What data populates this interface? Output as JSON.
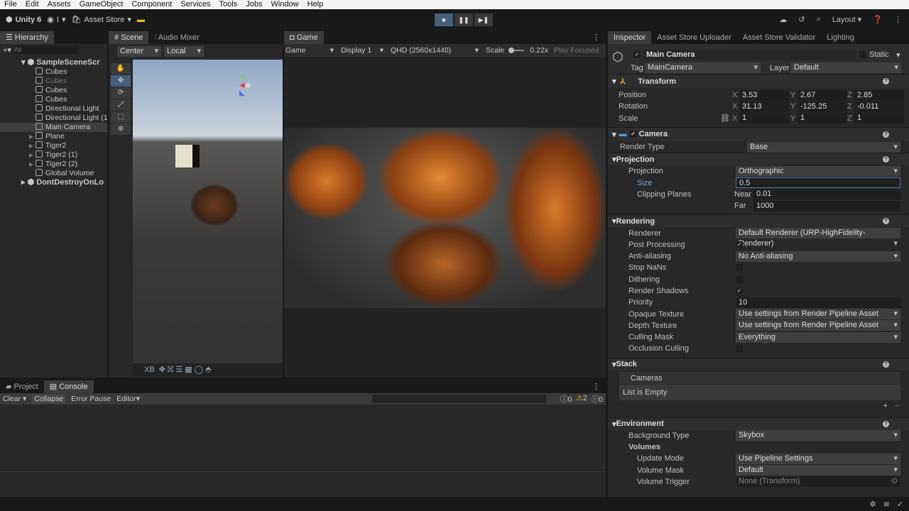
{
  "menu": [
    "File",
    "Edit",
    "Assets",
    "GameObject",
    "Component",
    "Services",
    "Tools",
    "Jobs",
    "Window",
    "Help"
  ],
  "toolbar": {
    "unity": "Unity 6",
    "account": "I",
    "asset_store": "Asset Store",
    "layout": "Layout"
  },
  "hierarchy": {
    "tab": "Hierarchy",
    "search_placeholder": "All",
    "scene": "SampleSceneScr",
    "items": [
      {
        "label": "Cubes",
        "disabled": false,
        "arrow": false
      },
      {
        "label": "Cubes",
        "disabled": true,
        "arrow": false
      },
      {
        "label": "Cubes",
        "disabled": false,
        "arrow": false
      },
      {
        "label": "Cubes",
        "disabled": false,
        "arrow": false
      },
      {
        "label": "Directional Light",
        "disabled": false,
        "arrow": false
      },
      {
        "label": "Directional Light (1)",
        "disabled": false,
        "arrow": false
      },
      {
        "label": "Main Camera",
        "disabled": false,
        "arrow": false,
        "selected": true
      },
      {
        "label": "Plane",
        "disabled": false,
        "arrow": true
      },
      {
        "label": "Tiger2",
        "disabled": false,
        "arrow": true
      },
      {
        "label": "Tiger2 (1)",
        "disabled": false,
        "arrow": true
      },
      {
        "label": "Tiger2 (2)",
        "disabled": false,
        "arrow": true
      },
      {
        "label": "Global Volume",
        "disabled": false,
        "arrow": false
      }
    ],
    "dontdestroy": "DontDestroyOnLo"
  },
  "scene": {
    "tab": "Scene",
    "tab2": "Audio Mixer",
    "pivot": "Center",
    "space": "Local",
    "bottom": "XB"
  },
  "game": {
    "tab": "Game",
    "mode": "Game",
    "display": "Display 1",
    "resolution": "QHD (2560x1440)",
    "scale_label": "Scale",
    "scale": "0.22x",
    "play": "Play Focused"
  },
  "console": {
    "tab_project": "Project",
    "tab_console": "Console",
    "clear": "Clear",
    "collapse": "Collapse",
    "error_pause": "Error Pause",
    "editor": "Editor",
    "info_count": "0",
    "warn_count": "2",
    "error_count": "0"
  },
  "inspector": {
    "tabs": [
      "Inspector",
      "Asset Store Uploader",
      "Asset Store Validator",
      "Lighting"
    ],
    "name": "Main Camera",
    "static": "Static",
    "tag_label": "Tag",
    "tag": "MainCamera",
    "layer_label": "Layer",
    "layer": "Default",
    "transform": {
      "title": "Transform",
      "position": {
        "label": "Position",
        "x": "3.53",
        "y": "2.67",
        "z": "2.85"
      },
      "rotation": {
        "label": "Rotation",
        "x": "31.13",
        "y": "-125.25",
        "z": "-0.011"
      },
      "scale": {
        "label": "Scale",
        "x": "1",
        "y": "1",
        "z": "1"
      }
    },
    "camera": {
      "title": "Camera",
      "render_type_label": "Render Type",
      "render_type": "Base",
      "projection": {
        "title": "Projection",
        "projection_label": "Projection",
        "projection": "Orthographic",
        "size_label": "Size",
        "size": "0.5",
        "clipping_label": "Clipping Planes",
        "near_label": "Near",
        "near": "0.01",
        "far_label": "Far",
        "far": "1000"
      },
      "rendering": {
        "title": "Rendering",
        "rows": [
          {
            "label": "Renderer",
            "value": "Default Renderer (URP-HighFidelity-Renderer)",
            "type": "dd"
          },
          {
            "label": "Post Processing",
            "value": "✓",
            "type": "check"
          },
          {
            "label": "Anti-aliasing",
            "value": "No Anti-aliasing",
            "type": "dd"
          },
          {
            "label": "Stop NaNs",
            "value": "",
            "type": "check"
          },
          {
            "label": "Dithering",
            "value": "",
            "type": "check"
          },
          {
            "label": "Render Shadows",
            "value": "✓",
            "type": "check"
          },
          {
            "label": "Priority",
            "value": "10",
            "type": "fld"
          },
          {
            "label": "Opaque Texture",
            "value": "Use settings from Render Pipeline Asset",
            "type": "dd"
          },
          {
            "label": "Depth Texture",
            "value": "Use settings from Render Pipeline Asset",
            "type": "dd"
          },
          {
            "label": "Culling Mask",
            "value": "Everything",
            "type": "dd"
          },
          {
            "label": "Occlusion Culling",
            "value": "",
            "type": "check"
          }
        ]
      },
      "stack": {
        "title": "Stack",
        "cameras": "Cameras",
        "empty": "List is Empty"
      },
      "environment": {
        "title": "Environment",
        "background_label": "Background Type",
        "background": "Skybox",
        "volumes": "Volumes",
        "update_label": "Update Mode",
        "update": "Use Pipeline Settings",
        "mask_label": "Volume Mask",
        "mask": "Default",
        "trigger_label": "Volume Trigger",
        "trigger": "None (Transform)"
      }
    }
  }
}
